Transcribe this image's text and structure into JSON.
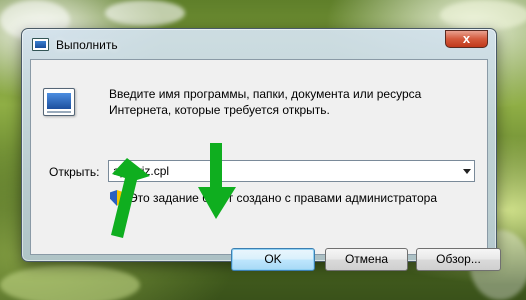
{
  "window": {
    "title": "Выполнить",
    "close_symbol": "x"
  },
  "dialog": {
    "description": "Введите имя программы, папки, документа или ресурса Интернета, которые требуется открыть.",
    "open_label": "Открыть:",
    "open_value": "appwiz.cpl",
    "admin_note": "Это задание будет создано с правами администратора"
  },
  "buttons": {
    "ok": "OK",
    "cancel": "Отмена",
    "browse": "Обзор..."
  },
  "icons": {
    "title_icon": "run-window-icon",
    "run_icon": "run-program-icon",
    "shield": "uac-shield-icon",
    "dropdown": "chevron-down-icon"
  },
  "colors": {
    "arrow": "#0fae1f",
    "close_button": "#c0391b",
    "ok_button_border": "#3c7fb1"
  }
}
